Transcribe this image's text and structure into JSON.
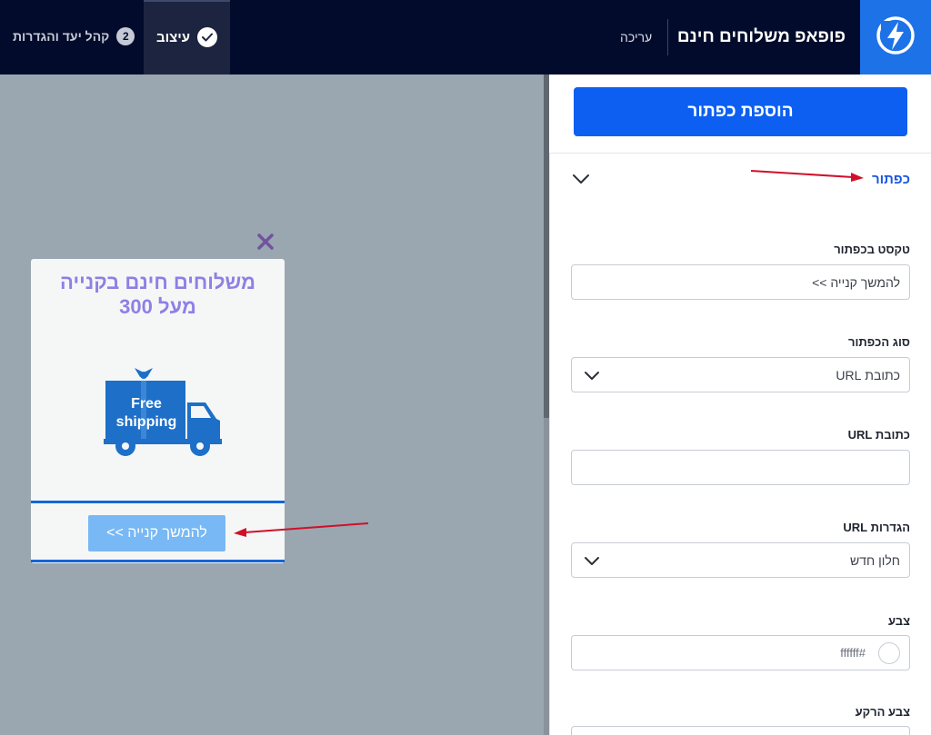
{
  "header": {
    "app_title": "פופאפ משלוחים חינם",
    "edit_link": "עריכה",
    "tabs": [
      {
        "label": "עיצוב",
        "state": "completed"
      },
      {
        "label": "קהל יעד והגדרות",
        "step": "2"
      }
    ],
    "logo_icon": "bolt-icon"
  },
  "popup": {
    "title": "משלוחים חינם בקנייה מעל 300",
    "image_text_line1": "Free",
    "image_text_line2": "shipping",
    "button_label": "להמשך קנייה >>",
    "close_icon": "close-icon"
  },
  "panel": {
    "add_button_label": "הוספת כפתור",
    "section_title": "כפתור",
    "fields": {
      "button_text": {
        "label": "טקסט בכפתור",
        "value": "להמשך קנייה >>"
      },
      "button_type": {
        "label": "סוג הכפתור",
        "value": "כתובת URL"
      },
      "url": {
        "label": "כתובת URL",
        "value": ""
      },
      "url_settings": {
        "label": "הגדרות URL",
        "value": "חלון חדש"
      },
      "color": {
        "label": "צבע",
        "value": "ffffff#"
      },
      "bg_color": {
        "label": "צבע הרקע"
      }
    }
  },
  "colors": {
    "topbar": "#020b2b",
    "accent": "#0c5ff0",
    "popup_title": "#8d80e6",
    "popup_button": "#78b8f5",
    "annotation_arrow": "#d0102a"
  }
}
